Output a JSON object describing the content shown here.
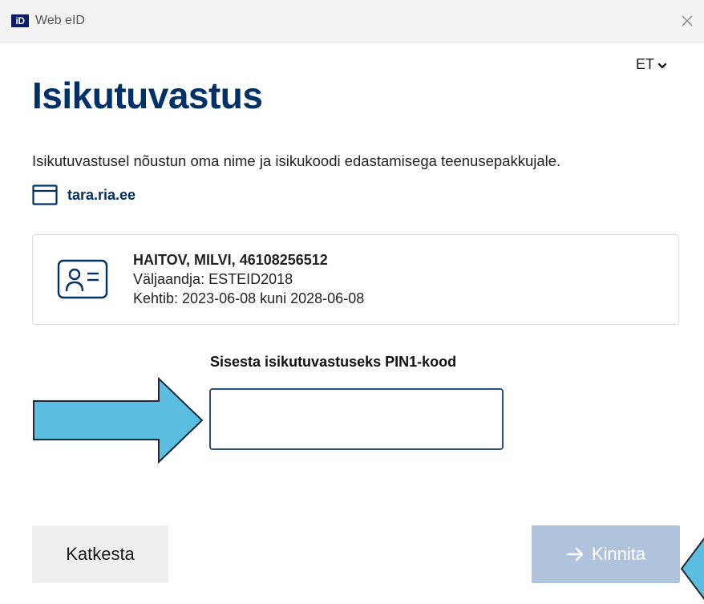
{
  "window": {
    "logo_text": "iD",
    "title": "Web eID",
    "close_label": "×"
  },
  "language": {
    "selected": "ET"
  },
  "page": {
    "heading": "Isikutuvastus",
    "consent_text": "Isikutuvastusel nõustun oma nime ja isikukoodi edastamisega teenusepakkujale.",
    "origin": "tara.ria.ee"
  },
  "certificate": {
    "holder": "HAITOV, MILVI, 46108256512",
    "issuer": "Väljaandja: ESTEID2018",
    "validity": "Kehtib: 2023-06-08 kuni 2028-06-08"
  },
  "pin": {
    "label": "Sisesta isikutuvastuseks PIN1-kood",
    "value": ""
  },
  "buttons": {
    "cancel": "Katkesta",
    "confirm": "Kinnita"
  },
  "colors": {
    "heading": "#003168",
    "confirm_disabled": "#b0c3dd",
    "annotation_arrow": "#5bbde0"
  },
  "icons": {
    "window": "browser-window-icon",
    "card": "id-card-icon",
    "language": "chevron-down-icon",
    "confirm": "arrow-right-icon"
  }
}
